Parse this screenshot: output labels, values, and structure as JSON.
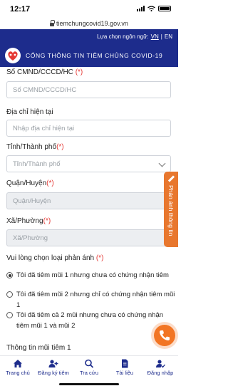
{
  "status_bar": {
    "time": "12:17"
  },
  "browser": {
    "url": "tiemchungcovid19.gov.vn"
  },
  "header": {
    "language_label": "Lựa chọn ngôn ngữ:",
    "languages": [
      "VN",
      "EN"
    ],
    "active_language": "VN",
    "portal_title": "CỔNG THÔNG TIN TIÊM CHỦNG COVID-19"
  },
  "form": {
    "id_number": {
      "label": "Số CMND/CCCD/HC",
      "required_mark": "(*)",
      "placeholder": "Số CMND/CCCD/HC"
    },
    "address": {
      "label": "Địa chỉ hiện tại",
      "placeholder": "Nhập địa chỉ hiện tại"
    },
    "province": {
      "label": "Tỉnh/Thành phố",
      "required_mark": "(*)",
      "placeholder": "Tỉnh/Thành phố"
    },
    "district": {
      "label": "Quận/Huyện",
      "required_mark": "(*)",
      "placeholder": "Quận/Huyện"
    },
    "ward": {
      "label": "Xã/Phường",
      "required_mark": "(*)",
      "placeholder": "Xã/Phường"
    },
    "feedback_type": {
      "label": "Vui lòng chọn loại phản ánh",
      "required_mark": "(*)",
      "options": [
        "Tôi đã tiêm mũi 1 nhưng chưa có chứng nhận tiêm",
        "Tôi đã tiêm mũi 2 nhưng chỉ có chứng nhận tiêm mũi 1",
        "Tôi đã tiêm cả 2 mũi nhưng chưa có chứng nhận tiêm mũi 1 và mũi 2"
      ],
      "selected_index": 0
    },
    "partial_section": "Thông tin mũi tiêm 1"
  },
  "side_tab": {
    "label": "Phản ánh thông tin"
  },
  "bottom_nav": {
    "items": [
      {
        "label": "Trang chủ",
        "icon": "home-icon"
      },
      {
        "label": "Đăng ký tiêm",
        "icon": "register-icon"
      },
      {
        "label": "Tra cứu",
        "icon": "search-icon"
      },
      {
        "label": "Tài liệu",
        "icon": "document-icon"
      },
      {
        "label": "Đăng nhập",
        "icon": "login-icon"
      }
    ]
  },
  "colors": {
    "header_bg": "#1d2c8c",
    "accent_orange": "#f27524",
    "required_red": "#e53935"
  }
}
